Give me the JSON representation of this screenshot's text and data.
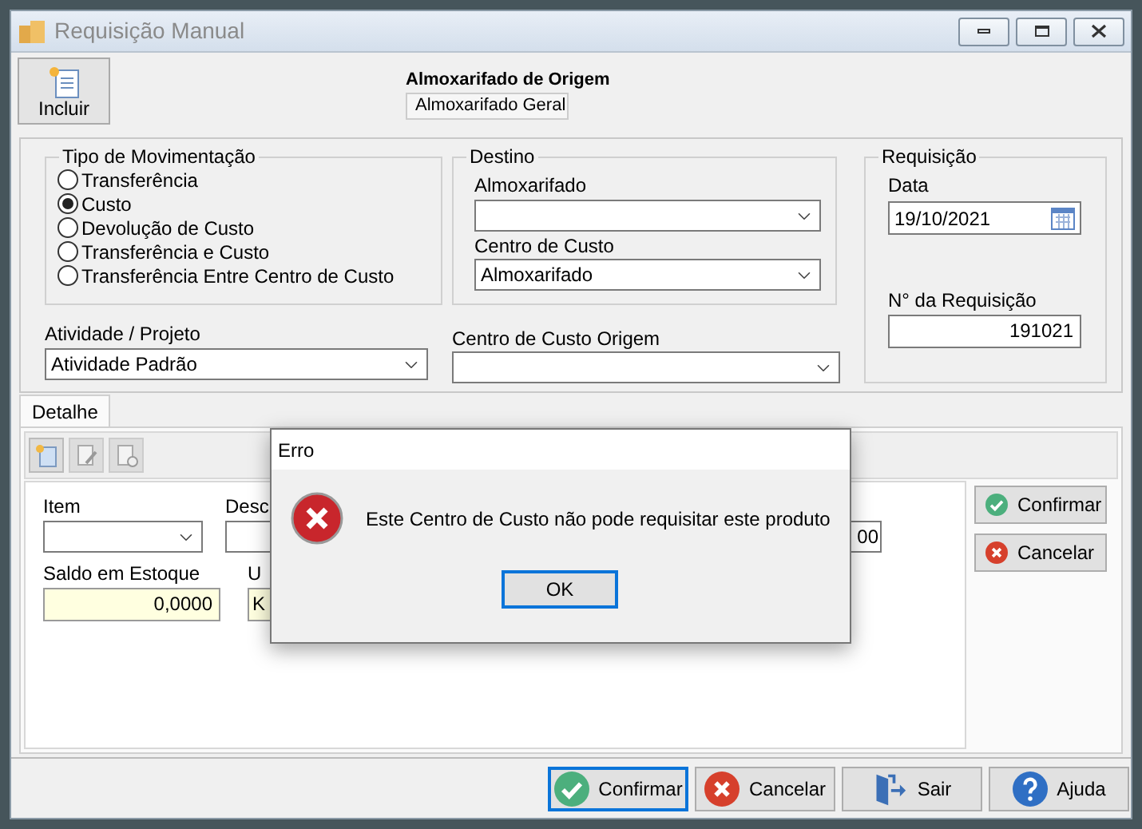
{
  "window": {
    "title": "Requisição Manual"
  },
  "toolbar": {
    "buttons": [
      {
        "label": "Incluir"
      }
    ]
  },
  "origem": {
    "label": "Almoxarifado de Origem",
    "value": "Almoxarifado Geral"
  },
  "tipo_movimentacao": {
    "title": "Tipo de Movimentação",
    "options": [
      {
        "label": "Transferência",
        "selected": false
      },
      {
        "label": "Custo",
        "selected": true
      },
      {
        "label": "Devolução de Custo",
        "selected": false
      },
      {
        "label": "Transferência e Custo",
        "selected": false
      },
      {
        "label": "Transferência Entre Centro de Custo",
        "selected": false
      }
    ]
  },
  "destino": {
    "title": "Destino",
    "almoxarifado": {
      "label": "Almoxarifado"
    },
    "centro_de_custo": {
      "label": "Centro de Custo",
      "value": "Almoxarifado"
    }
  },
  "requisicao": {
    "title": "Requisição",
    "data": {
      "label": "Data",
      "value": "19/10/2021"
    },
    "numero": {
      "label": "N°  da Requisição",
      "value": "191021"
    }
  },
  "atividade": {
    "label": "Atividade / Projeto",
    "value": "Atividade Padrão"
  },
  "centro_custo_origem": {
    "label": "Centro de Custo Origem"
  },
  "tabs": [
    {
      "label": "Detalhe",
      "selected": true
    }
  ],
  "detalhe": {
    "item": {
      "label": "Item"
    },
    "descricao": {
      "label": "Desc"
    },
    "column_3": {
      "value": "00"
    },
    "saldo": {
      "label": "Saldo em Estoque",
      "value": "0,0000"
    },
    "un": {
      "label": "U",
      "value": "K"
    }
  },
  "side_buttons": [
    {
      "label": "Confirmar",
      "kind": "confirm"
    },
    {
      "label": "Cancelar",
      "kind": "cancel"
    }
  ],
  "footer_buttons": [
    {
      "label": "Confirmar",
      "kind": "confirm",
      "focused": true
    },
    {
      "label": "Cancelar",
      "kind": "cancel",
      "focused": false
    },
    {
      "label": "Sair",
      "kind": "exit",
      "focused": false
    },
    {
      "label": "Ajuda",
      "kind": "help",
      "focused": false
    }
  ],
  "dialog": {
    "title": "Erro",
    "message": "Este Centro de Custo não pode requisitar este produto",
    "button": "OK"
  }
}
